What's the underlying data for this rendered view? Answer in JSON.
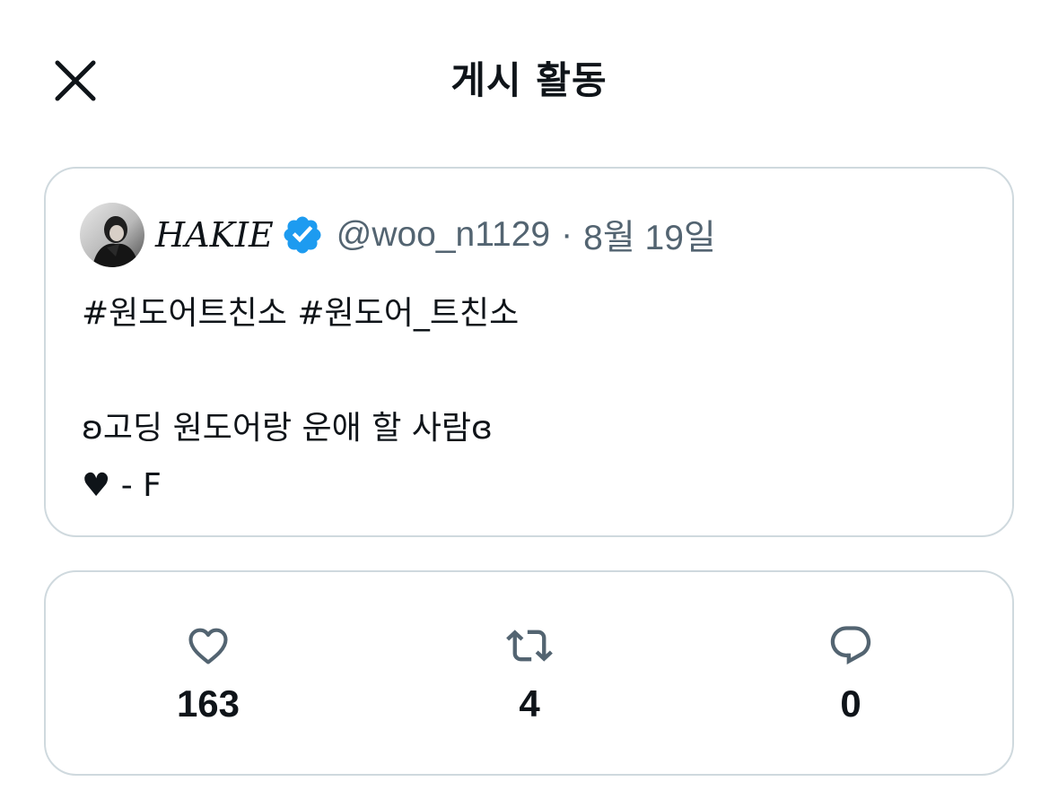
{
  "header": {
    "title": "게시 활동",
    "close_icon": "close-icon"
  },
  "post": {
    "avatar": "avatar",
    "display_name": "HAKIE",
    "verified_icon": "verified-badge-icon",
    "handle": "@woo_n1129",
    "separator": "·",
    "date": "8월 19일",
    "lines": [
      "#원도어트친소 #원도어_트친소",
      "",
      "ʚ고딩 원도어랑 운애 할 사람ɞ",
      "♥ - F"
    ]
  },
  "stats": {
    "likes": {
      "icon": "heart-icon",
      "value": "163"
    },
    "reposts": {
      "icon": "repost-icon",
      "value": "4"
    },
    "replies": {
      "icon": "reply-icon",
      "value": "0"
    }
  },
  "colors": {
    "text": "#0f1419",
    "secondary": "#536471",
    "border": "#cfd9de",
    "verified": "#1d9bf0"
  }
}
